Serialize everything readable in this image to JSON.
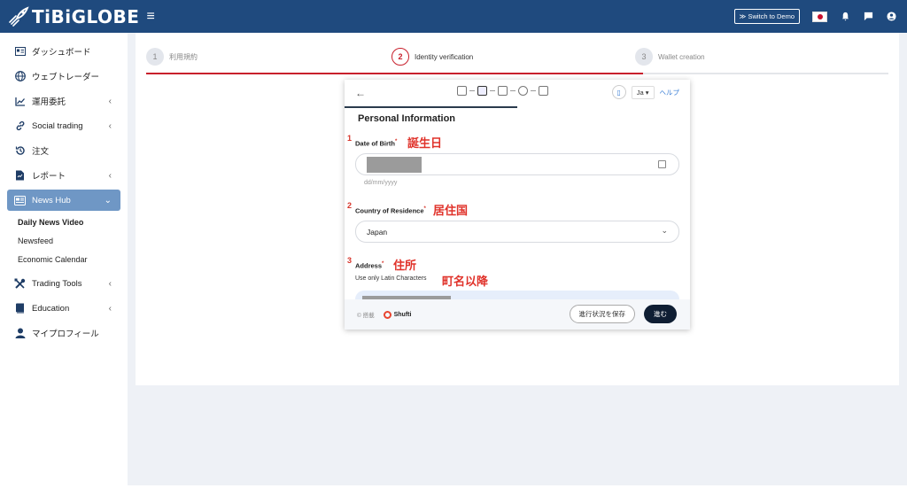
{
  "header": {
    "logo_text": "TiBiGLOBE",
    "switch_demo_label": "≫ Switch to Demo",
    "accent_color": "#1f4a7e"
  },
  "sidebar": {
    "items": [
      {
        "label": "ダッシュボード",
        "icon": "id-card-icon"
      },
      {
        "label": "ウェブトレーダー",
        "icon": "globe-icon"
      },
      {
        "label": "運用委託",
        "icon": "chart-line-icon",
        "expandable": true
      },
      {
        "label": "Social trading",
        "icon": "link-icon",
        "expandable": true
      },
      {
        "label": "注文",
        "icon": "history-icon"
      },
      {
        "label": "レポート",
        "icon": "report-icon",
        "expandable": true
      },
      {
        "label": "News Hub",
        "icon": "newspaper-icon",
        "expandable": true,
        "active": true
      },
      {
        "label": "Trading Tools",
        "icon": "tools-icon",
        "expandable": true
      },
      {
        "label": "Education",
        "icon": "book-icon",
        "expandable": true
      },
      {
        "label": "マイプロフィール",
        "icon": "user-icon"
      }
    ],
    "news_hub_subitems": [
      "Daily News Video",
      "Newsfeed",
      "Economic Calendar"
    ]
  },
  "stepper": {
    "steps": [
      {
        "number": "1",
        "label": "利用規約"
      },
      {
        "number": "2",
        "label": "Identity verification",
        "current": true
      },
      {
        "number": "3",
        "label": "Wallet creation"
      }
    ],
    "progress_fraction": 0.67
  },
  "widget": {
    "lang": "Ja",
    "help": "ヘルプ",
    "title": "Personal Information",
    "fields": [
      {
        "number": "1",
        "label": "Date of Birth",
        "annotation": "誕生日",
        "hint": "dd/mm/yyyy"
      },
      {
        "number": "2",
        "label": "Country of Residence",
        "annotation": "居住国",
        "value": "Japan"
      },
      {
        "number": "3",
        "label": "Address",
        "annotation": "住所",
        "sub_label": "Use only Latin Characters",
        "sub_annotation": "町名以降"
      }
    ],
    "powered_by": "© 搭載",
    "brand": "Shufti",
    "save_label": "進行状況を保存",
    "next_label": "進む"
  }
}
